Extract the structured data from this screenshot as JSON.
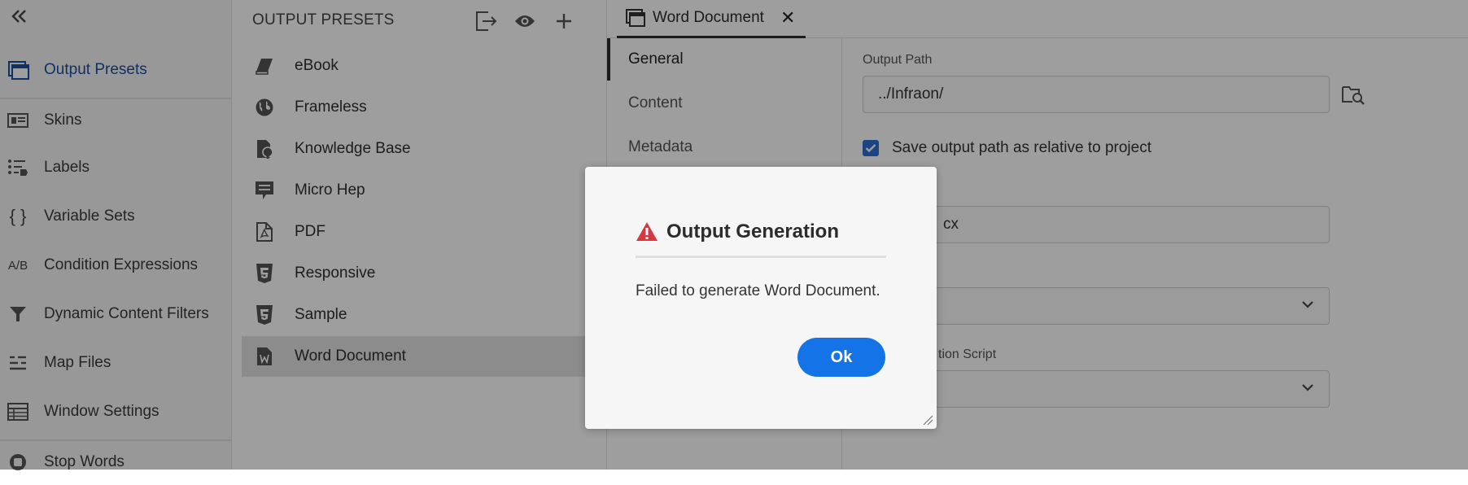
{
  "nav": {
    "collapse_icon": "double-chevron-left-icon",
    "items": [
      {
        "label": "Output Presets",
        "icon": "window-stack-icon",
        "active": true
      },
      {
        "label": "Skins",
        "icon": "skin-icon"
      },
      {
        "label": "Labels",
        "icon": "labels-list-icon"
      },
      {
        "label": "Variable Sets",
        "icon": "curly-braces-icon",
        "glyph": "{ }"
      },
      {
        "label": "Condition Expressions",
        "icon": "ab-icon",
        "glyph": "A/B"
      },
      {
        "label": "Dynamic Content Filters",
        "icon": "filter-icon"
      },
      {
        "label": "Map Files",
        "icon": "map-files-icon"
      },
      {
        "label": "Window Settings",
        "icon": "table-icon"
      },
      {
        "label": "Stop Words",
        "icon": "stop-icon"
      }
    ]
  },
  "presets": {
    "title": "OUTPUT PRESETS",
    "items": [
      {
        "label": "eBook",
        "icon": "ebook-icon"
      },
      {
        "label": "Frameless",
        "icon": "globe-icon"
      },
      {
        "label": "Knowledge Base",
        "icon": "knowledge-base-icon"
      },
      {
        "label": "Micro Hep",
        "icon": "speech-bubble-icon"
      },
      {
        "label": "PDF",
        "icon": "pdf-icon"
      },
      {
        "label": "Responsive",
        "icon": "html5-icon"
      },
      {
        "label": "Sample",
        "icon": "html5-icon"
      },
      {
        "label": "Word Document",
        "icon": "word-icon",
        "selected": true
      }
    ]
  },
  "editor": {
    "tab": {
      "label": "Word Document",
      "close": "✕"
    },
    "sections": [
      "General",
      "Content",
      "Metadata"
    ],
    "form": {
      "output_path_label": "Output Path",
      "output_path_value": "../Infraon/",
      "relative_checkbox_label": "Save output path as relative to project",
      "file_name_partial": "cx",
      "script_label_partial": "tion Script"
    }
  },
  "dialog": {
    "title": "Output Generation",
    "message": "Failed to generate Word Document.",
    "ok_label": "Ok",
    "warning_color": "#d7373f",
    "button_color": "#1473e6"
  }
}
